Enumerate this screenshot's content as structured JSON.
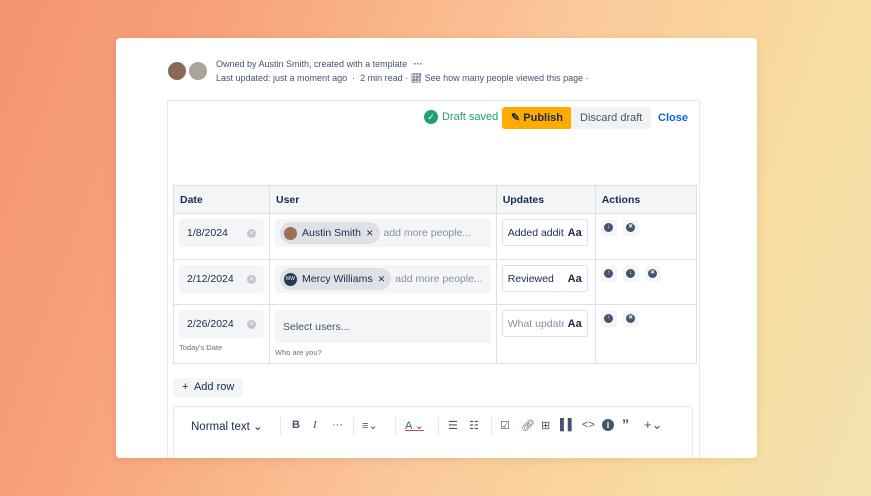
{
  "header": {
    "owner_text": "Owned by Austin Smith, created with a template",
    "more": "···",
    "last_updated": "Last updated: just a moment ago",
    "read_time": "2 min read",
    "views_link": "See how many people viewed this page"
  },
  "actions": {
    "draft_status": "Draft saved",
    "publish": "Publish",
    "discard": "Discard draft",
    "close": "Close"
  },
  "table": {
    "headers": [
      "Date",
      "User",
      "Updates",
      "Actions"
    ],
    "rows": [
      {
        "date": "1/8/2024",
        "user": "Austin Smith",
        "initials": "",
        "user_placeholder": "add more people...",
        "update": "Added additi",
        "update_placeholder": ""
      },
      {
        "date": "2/12/2024",
        "user": "Mercy Williams",
        "initials": "MW",
        "user_placeholder": "add more people...",
        "update": "Reviewed"
      },
      {
        "date": "2/26/2024",
        "date_help": "Today's Date",
        "user_placeholder": "Select users...",
        "user_help": "Who are you?",
        "update_placeholder": "What update"
      }
    ],
    "aa": "Aa"
  },
  "add_row": "Add row",
  "toolbar": {
    "text_style": "Normal text"
  },
  "colors": {
    "publish": "#ffab00",
    "draft": "#22a06b",
    "link": "#0c66e4"
  }
}
